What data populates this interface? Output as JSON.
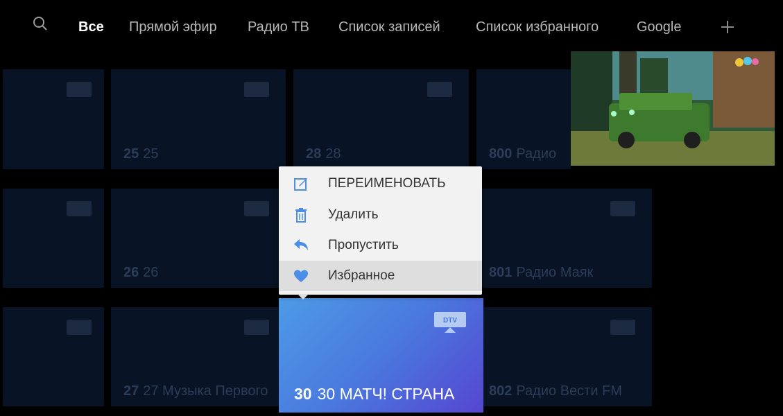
{
  "tabs": [
    {
      "label": "Все",
      "active": true
    },
    {
      "label": "Прямой эфир"
    },
    {
      "label": "Радио ТВ"
    },
    {
      "label": "Список записей"
    },
    {
      "label": "Список избранного"
    },
    {
      "label": "Google"
    }
  ],
  "icons": {
    "search": "search-icon",
    "add": "plus-icon",
    "dtv": "dtv-icon"
  },
  "channels": {
    "row1": [
      {
        "num": "25",
        "name": "25"
      },
      {
        "num": "28",
        "name": "28"
      },
      {
        "num": "800",
        "name": "Радио"
      }
    ],
    "row2": [
      {
        "num": "26",
        "name": "26"
      },
      {
        "num": "801",
        "name": "Радио Маяк"
      }
    ],
    "row3": [
      {
        "num": "27",
        "name": "27 Музыка Первого"
      },
      {
        "num": "802",
        "name": "Радио Вести FM"
      }
    ]
  },
  "focused_channel": {
    "num": "30",
    "name": "30 МАТЧ! СТРАНА",
    "badge": "DTV"
  },
  "context_menu": {
    "items": [
      {
        "label": "ПЕРЕИМЕНОВАТЬ",
        "icon": "edit-icon"
      },
      {
        "label": "Удалить",
        "icon": "trash-icon"
      },
      {
        "label": "Пропустить",
        "icon": "skip-icon"
      },
      {
        "label": "Избранное",
        "icon": "heart-icon",
        "selected": true
      }
    ]
  },
  "colors": {
    "accent": "#4a8ee6",
    "focus_gradient_end": "#5546d0",
    "menu_bg": "#f2f2f2",
    "menu_icon": "#4a8ee6"
  }
}
